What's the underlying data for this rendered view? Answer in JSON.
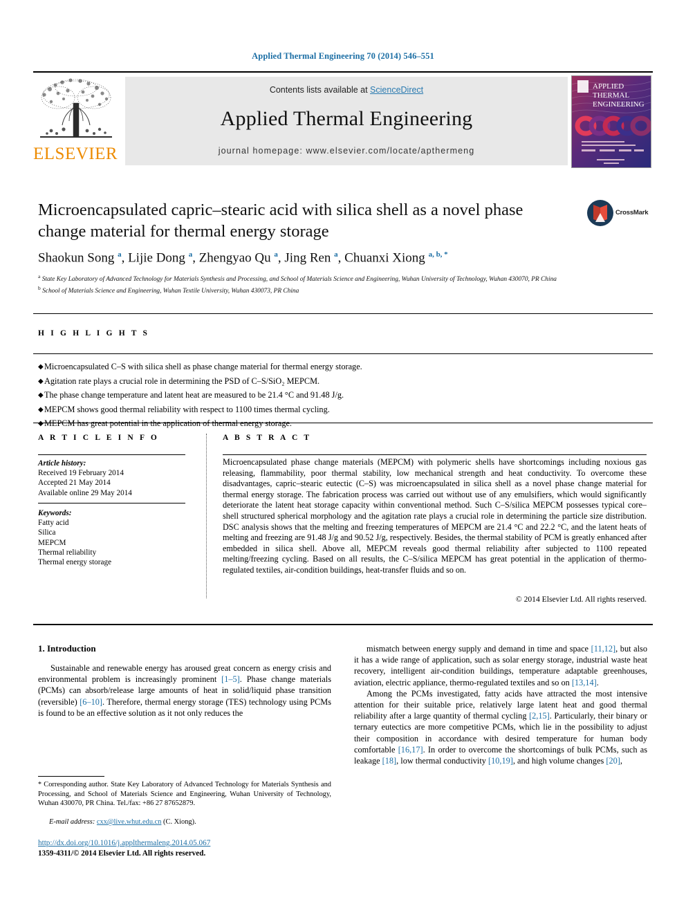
{
  "running_head": "Applied Thermal Engineering 70 (2014) 546–551",
  "masthead": {
    "contents_prefix": "Contents lists available at ",
    "sciencedirect": "ScienceDirect",
    "journal_name": "Applied Thermal Engineering",
    "homepage": "journal homepage: www.elsevier.com/locate/apthermeng",
    "publisher_name": "ELSEVIER",
    "cover_title_lines": [
      "APPLIED",
      "THERMAL",
      "ENGINEERING"
    ]
  },
  "article": {
    "title": "Microencapsulated capric–stearic acid with silica shell as a novel phase change material for thermal energy storage",
    "crossmark_label": "CrossMark",
    "authors_html": "Shaokun Song <sup>a</sup>, Lijie Dong <sup>a</sup>, Zhengyao Qu <sup>a</sup>, Jing Ren <sup>a</sup>, Chuanxi Xiong <sup>a, b, *</sup>",
    "affiliation_a": "State Key Laboratory of Advanced Technology for Materials Synthesis and Processing, and School of Materials Science and Engineering, Wuhan University of Technology, Wuhan 430070, PR China",
    "affiliation_b": "School of Materials Science and Engineering, Wuhan Textile University, Wuhan 430073, PR China"
  },
  "highlights": {
    "heading": "H I G H L I G H T S",
    "items": [
      "Microencapsulated C–S with silica shell as phase change material for thermal energy storage.",
      "Agitation rate plays a crucial role in determining the PSD of C–S/SiO₂ MEPCM.",
      "The phase change temperature and latent heat are measured to be 21.4 °C and 91.48 J/g.",
      "MEPCM shows good thermal reliability with respect to 1100 times thermal cycling.",
      "MEPCM has great potential in the application of thermal energy storage."
    ]
  },
  "article_info": {
    "heading": "A R T I C L E   I N F O",
    "history_label": "Article history:",
    "history": [
      "Received 19 February 2014",
      "Accepted 21 May 2014",
      "Available online 29 May 2014"
    ],
    "keywords_label": "Keywords:",
    "keywords": [
      "Fatty acid",
      "Silica",
      "MEPCM",
      "Thermal reliability",
      "Thermal energy storage"
    ]
  },
  "abstract": {
    "heading": "A B S T R A C T",
    "text": "Microencapsulated phase change materials (MEPCM) with polymeric shells have shortcomings including noxious gas releasing, flammability, poor thermal stability, low mechanical strength and heat conductivity. To overcome these disadvantages, capric–stearic eutectic (C–S) was microencapsulated in silica shell as a novel phase change material for thermal energy storage. The fabrication process was carried out without use of any emulsifiers, which would significantly deteriorate the latent heat storage capacity within conventional method. Such C–S/silica MEPCM possesses typical core–shell structured spherical morphology and the agitation rate plays a crucial role in determining the particle size distribution. DSC analysis shows that the melting and freezing temperatures of MEPCM are 21.4 °C and 22.2 °C, and the latent heats of melting and freezing are 91.48 J/g and 90.52 J/g, respectively. Besides, the thermal stability of PCM is greatly enhanced after embedded in silica shell. Above all, MEPCM reveals good thermal reliability after subjected to 1100 repeated melting/freezing cycling. Based on all results, the C–S/silica MEPCM has great potential in the application of thermo-regulated textiles, air-condition buildings, heat-transfer fluids and so on.",
    "copyright": "© 2014 Elsevier Ltd. All rights reserved."
  },
  "body": {
    "section_number_title": "1. Introduction",
    "left_paragraph_1_html": "Sustainable and renewable energy has aroused great concern as energy crisis and environmental problem is increasingly prominent <span class=\"ref\">[1–5]</span>. Phase change materials (PCMs) can absorb/release large amounts of heat in solid/liquid phase transition (reversible) <span class=\"ref\">[6–10]</span>. Therefore, thermal energy storage (TES) technology using PCMs is found to be an effective solution as it not only reduces the",
    "right_paragraph_1_html": "mismatch between energy supply and demand in time and space <span class=\"ref\">[11,12]</span>, but also it has a wide range of application, such as solar energy storage, industrial waste heat recovery, intelligent air-condition buildings, temperature adaptable greenhouses, aviation, electric appliance, thermo-regulated textiles and so on <span class=\"ref\">[13,14]</span>.",
    "right_paragraph_2_html": "Among the PCMs investigated, fatty acids have attracted the most intensive attention for their suitable price, relatively large latent heat and good thermal reliability after a large quantity of thermal cycling <span class=\"ref\">[2,15]</span>. Particularly, their binary or ternary eutectics are more competitive PCMs, which lie in the possibility to adjust their composition in accordance with desired temperature for human body comfortable <span class=\"ref\">[16,17]</span>. In order to overcome the shortcomings of bulk PCMs, such as leakage <span class=\"ref\">[18]</span>, low thermal conductivity <span class=\"ref\">[10,19]</span>, and high volume changes <span class=\"ref\">[20]</span>,"
  },
  "footnote": {
    "corresponding_html": "<span class=\"star\">*</span> Corresponding author. State Key Laboratory of Advanced Technology for Materials Synthesis and Processing, and School of Materials Science and Engineering, Wuhan University of Technology, Wuhan 430070, PR China. Tel./fax: +86 27 87652879.",
    "email_label": "E-mail address:",
    "email": "cxx@live.whut.edu.cn",
    "email_owner": "(C. Xiong)."
  },
  "doi_block": {
    "doi_url": "http://dx.doi.org/10.1016/j.applthermaleng.2014.05.067",
    "issn_line": "1359-4311/© 2014 Elsevier Ltd. All rights reserved."
  },
  "colors": {
    "link_blue": "#1d6fa5",
    "elsevier_orange": "#ed8b00",
    "masthead_gray": "#e8e8e8"
  }
}
